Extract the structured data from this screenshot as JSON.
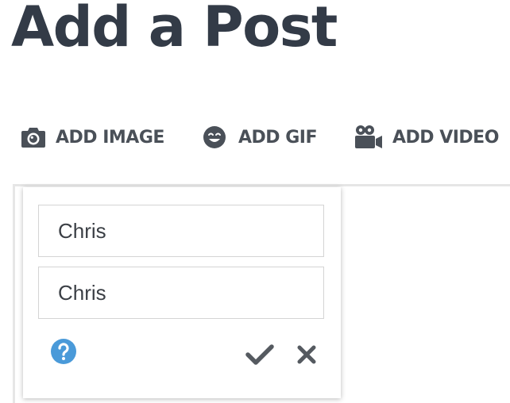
{
  "page": {
    "title": "Add a Post"
  },
  "toolbar": {
    "add_image": {
      "label": "ADD IMAGE",
      "icon": "camera-icon"
    },
    "add_gif": {
      "label": "ADD GIF",
      "icon": "smiley-icon"
    },
    "add_video": {
      "label": "ADD VIDEO",
      "icon": "video-camera-icon"
    }
  },
  "popover": {
    "field_1_value": "Chris",
    "field_2_value": "Chris",
    "help_icon": "question-circle-icon",
    "confirm_icon": "checkmark-icon",
    "cancel_icon": "close-icon"
  },
  "colors": {
    "title": "#333b47",
    "toolbar_text": "#4a5058",
    "help_blue": "#4a9ad9",
    "action_gray": "#555a60"
  }
}
